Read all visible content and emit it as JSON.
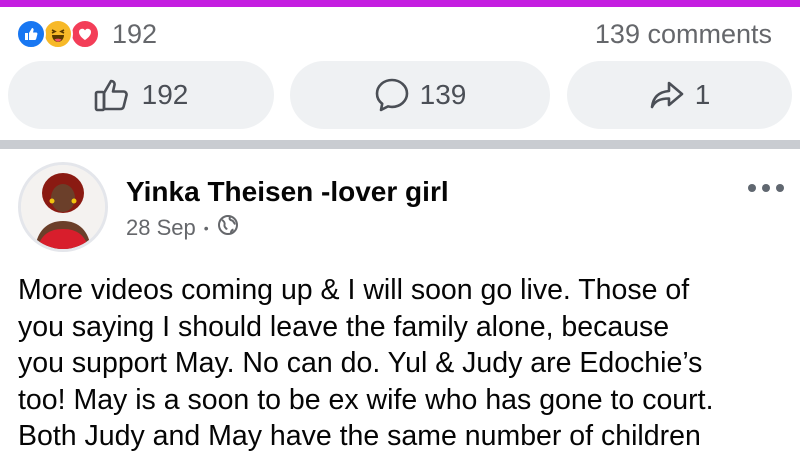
{
  "colors": {
    "accent_bar": "#c41ee0",
    "like_blue": "#1877f2",
    "haha_yellow": "#f7b928",
    "love_red": "#f33e58",
    "secondary_text": "#65676b",
    "button_bg": "#eff1f3"
  },
  "summary": {
    "reaction_icons": [
      "like-icon",
      "haha-icon",
      "love-icon"
    ],
    "reaction_count": "192",
    "comments_text": "139 comments"
  },
  "actions": {
    "like": {
      "icon": "thumbs-up-icon",
      "label": "192"
    },
    "comment": {
      "icon": "comment-bubble-icon",
      "label": "139"
    },
    "share": {
      "icon": "share-arrow-icon",
      "label": "1"
    }
  },
  "post": {
    "author": "Yinka Theisen -lover girl",
    "date": "28 Sep",
    "separator": "•",
    "audience_icon": "globe-icon",
    "menu_icon": "more-options-icon",
    "lines": [
      "More videos coming up & I will soon go live. Those of",
      "you saying I should leave the family alone, because",
      "you support May. No can do. Yul & Judy are Edochie’s",
      "too! May is a soon to be ex wife who has gone to court.",
      "Both Judy and May have the same number of children"
    ]
  }
}
